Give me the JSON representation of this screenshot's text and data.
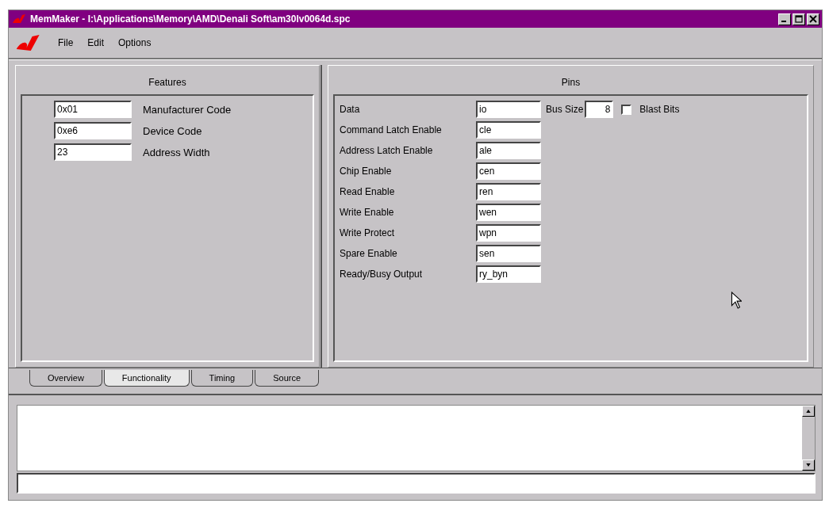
{
  "window": {
    "title": "MemMaker - I:\\Applications\\Memory\\AMD\\Denali Soft\\am30lv0064d.spc"
  },
  "menu": [
    "File",
    "Edit",
    "Options"
  ],
  "features": {
    "title": "Features",
    "fields": [
      {
        "value": "0x01",
        "label": "Manufacturer Code"
      },
      {
        "value": "0xe6",
        "label": "Device Code"
      },
      {
        "value": "23",
        "label": "Address Width"
      }
    ]
  },
  "pins": {
    "title": "Pins",
    "bus_size": {
      "label": "Bus Size",
      "value": "8"
    },
    "blast_bits": {
      "label": "Blast Bits",
      "checked": false
    },
    "fields": [
      {
        "label": "Data",
        "value": "io"
      },
      {
        "label": "Command Latch Enable",
        "value": "cle"
      },
      {
        "label": "Address Latch Enable",
        "value": "ale"
      },
      {
        "label": "Chip Enable",
        "value": "cen"
      },
      {
        "label": "Read Enable",
        "value": "ren"
      },
      {
        "label": "Write Enable",
        "value": "wen"
      },
      {
        "label": "Write Protect",
        "value": "wpn"
      },
      {
        "label": "Spare Enable",
        "value": "sen"
      },
      {
        "label": "Ready/Busy Output",
        "value": "ry_byn"
      }
    ]
  },
  "tabs": [
    {
      "label": "Overview",
      "selected": false
    },
    {
      "label": "Functionality",
      "selected": true
    },
    {
      "label": "Timing",
      "selected": false
    },
    {
      "label": "Source",
      "selected": false
    }
  ]
}
